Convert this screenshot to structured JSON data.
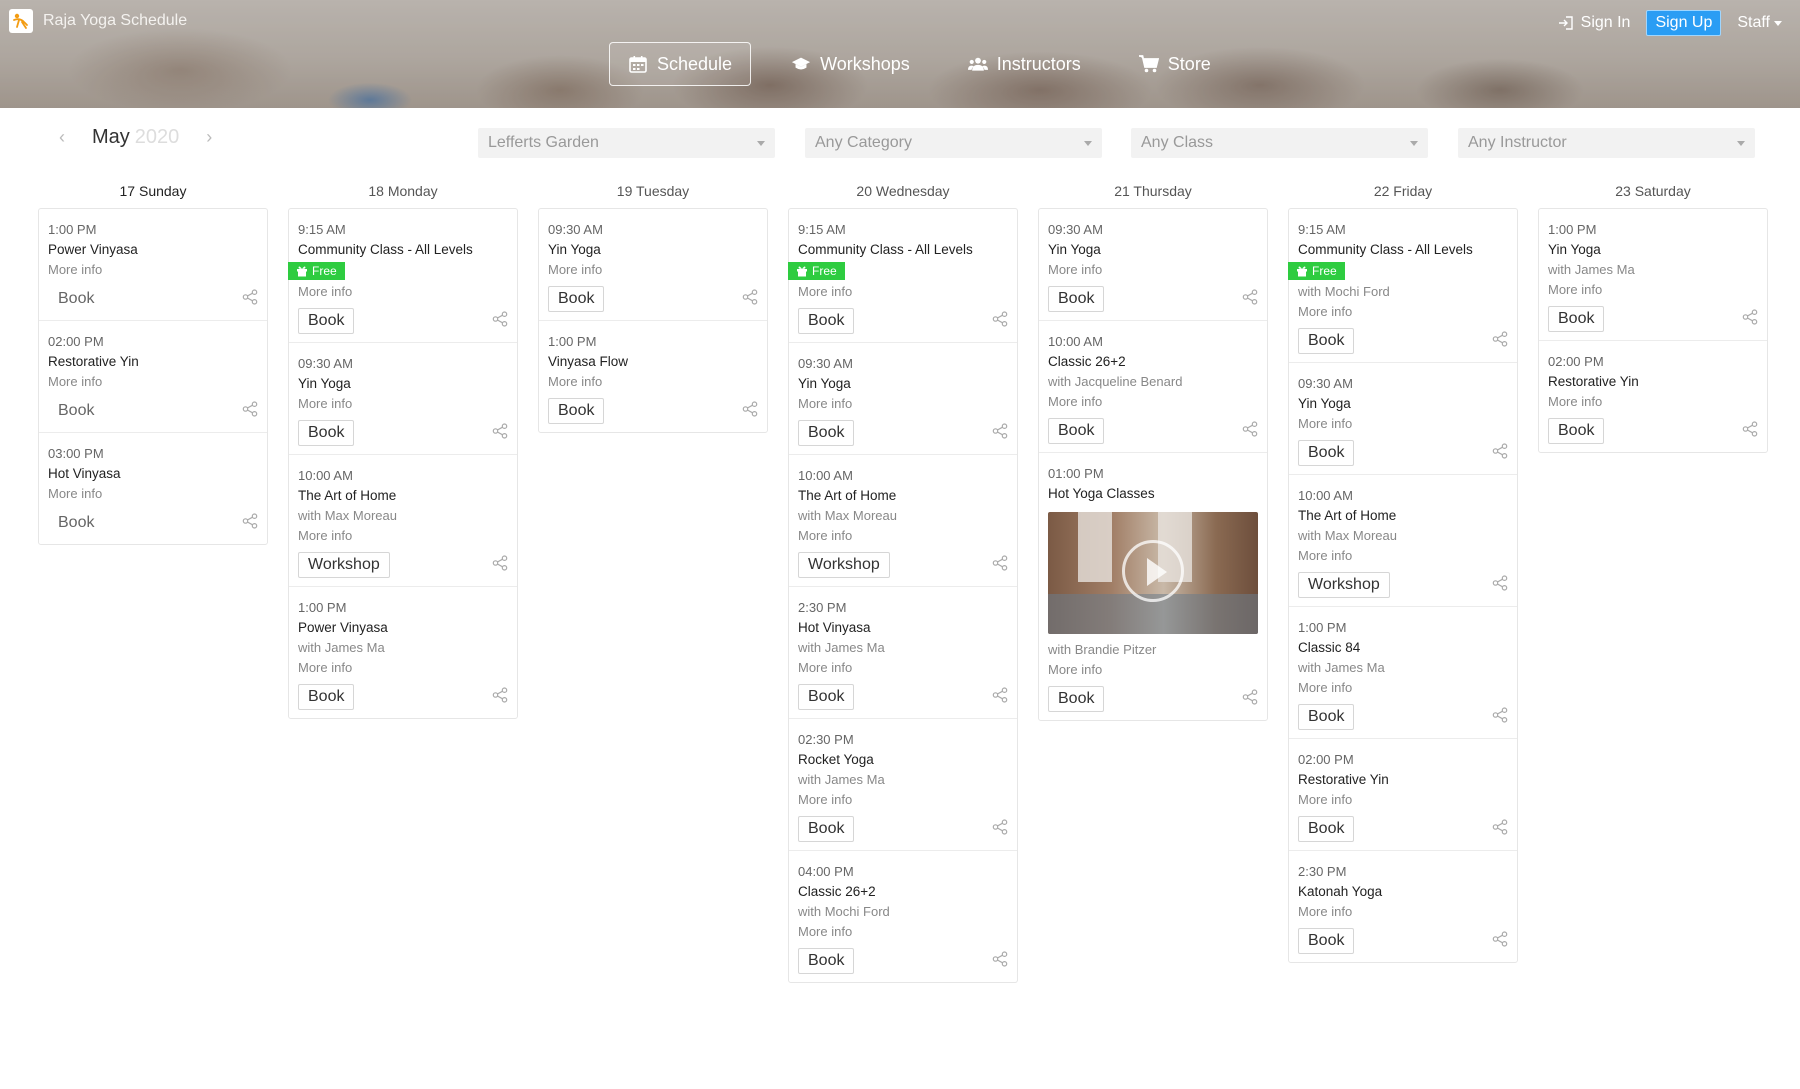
{
  "header": {
    "brand": "Raja Yoga Schedule",
    "sign_in": "Sign In",
    "sign_up": "Sign Up",
    "staff": "Staff",
    "nav": [
      {
        "label": "Schedule",
        "icon": "calendar-icon",
        "active": true
      },
      {
        "label": "Workshops",
        "icon": "graduation-cap-icon",
        "active": false
      },
      {
        "label": "Instructors",
        "icon": "users-icon",
        "active": false
      },
      {
        "label": "Store",
        "icon": "cart-icon",
        "active": false
      }
    ]
  },
  "filters": {
    "month": "May",
    "year": "2020",
    "location": "Lefferts Garden",
    "category": "Any Category",
    "class": "Any Class",
    "instructor": "Any Instructor"
  },
  "days": [
    {
      "label": "17 Sunday",
      "slots": [
        {
          "time": "1:00 PM",
          "name": "Power Vinyasa",
          "more": "More info",
          "action": "Book",
          "plain": true
        },
        {
          "time": "02:00 PM",
          "name": "Restorative Yin",
          "more": "More info",
          "action": "Book",
          "plain": true
        },
        {
          "time": "03:00 PM",
          "name": "Hot Vinyasa",
          "more": "More info",
          "action": "Book",
          "plain": true
        }
      ]
    },
    {
      "label": "18 Monday",
      "slots": [
        {
          "time": "9:15 AM",
          "name": "Community Class - All Levels",
          "free": "Free",
          "more": "More info",
          "action": "Book"
        },
        {
          "time": "09:30 AM",
          "name": "Yin Yoga",
          "more": "More info",
          "action": "Book"
        },
        {
          "time": "10:00 AM",
          "name": "The Art of Home",
          "instructor": "with Max Moreau",
          "more": "More info",
          "action": "Workshop"
        },
        {
          "time": "1:00 PM",
          "name": "Power Vinyasa",
          "instructor": "with James Ma",
          "more": "More info",
          "action": "Book"
        }
      ]
    },
    {
      "label": "19 Tuesday",
      "slots": [
        {
          "time": "09:30 AM",
          "name": "Yin Yoga",
          "more": "More info",
          "action": "Book"
        },
        {
          "time": "1:00 PM",
          "name": "Vinyasa Flow",
          "more": "More info",
          "action": "Book"
        }
      ]
    },
    {
      "label": "20 Wednesday",
      "slots": [
        {
          "time": "9:15 AM",
          "name": "Community Class - All Levels",
          "free": "Free",
          "more": "More info",
          "action": "Book"
        },
        {
          "time": "09:30 AM",
          "name": "Yin Yoga",
          "more": "More info",
          "action": "Book"
        },
        {
          "time": "10:00 AM",
          "name": "The Art of Home",
          "instructor": "with Max Moreau",
          "more": "More info",
          "action": "Workshop"
        },
        {
          "time": "2:30 PM",
          "name": "Hot Vinyasa",
          "instructor": "with James Ma",
          "more": "More info",
          "action": "Book"
        },
        {
          "time": "02:30 PM",
          "name": "Rocket Yoga",
          "instructor": "with James Ma",
          "more": "More info",
          "action": "Book"
        },
        {
          "time": "04:00 PM",
          "name": "Classic 26+2",
          "instructor": "with Mochi Ford",
          "more": "More info",
          "action": "Book"
        }
      ]
    },
    {
      "label": "21 Thursday",
      "slots": [
        {
          "time": "09:30 AM",
          "name": "Yin Yoga",
          "more": "More info",
          "action": "Book"
        },
        {
          "time": "10:00 AM",
          "name": "Classic 26+2",
          "instructor": "with Jacqueline Benard",
          "more": "More info",
          "action": "Book"
        },
        {
          "time": "01:00 PM",
          "name": "Hot Yoga Classes",
          "video": true,
          "instructor": "with Brandie Pitzer",
          "more": "More info",
          "action": "Book"
        }
      ]
    },
    {
      "label": "22 Friday",
      "slots": [
        {
          "time": "9:15 AM",
          "name": "Community Class - All Levels",
          "free": "Free",
          "instructor": "with Mochi Ford",
          "more": "More info",
          "action": "Book"
        },
        {
          "time": "09:30 AM",
          "name": "Yin Yoga",
          "more": "More info",
          "action": "Book"
        },
        {
          "time": "10:00 AM",
          "name": "The Art of Home",
          "instructor": "with Max Moreau",
          "more": "More info",
          "action": "Workshop"
        },
        {
          "time": "1:00 PM",
          "name": "Classic 84",
          "instructor": "with James Ma",
          "more": "More info",
          "action": "Book"
        },
        {
          "time": "02:00 PM",
          "name": "Restorative Yin",
          "more": "More info",
          "action": "Book"
        },
        {
          "time": "2:30 PM",
          "name": "Katonah Yoga",
          "more": "More info",
          "action": "Book"
        }
      ]
    },
    {
      "label": "23 Saturday",
      "slots": [
        {
          "time": "1:00 PM",
          "name": "Yin Yoga",
          "instructor": "with James Ma",
          "more": "More info",
          "action": "Book"
        },
        {
          "time": "02:00 PM",
          "name": "Restorative Yin",
          "more": "More info",
          "action": "Book"
        }
      ]
    }
  ]
}
